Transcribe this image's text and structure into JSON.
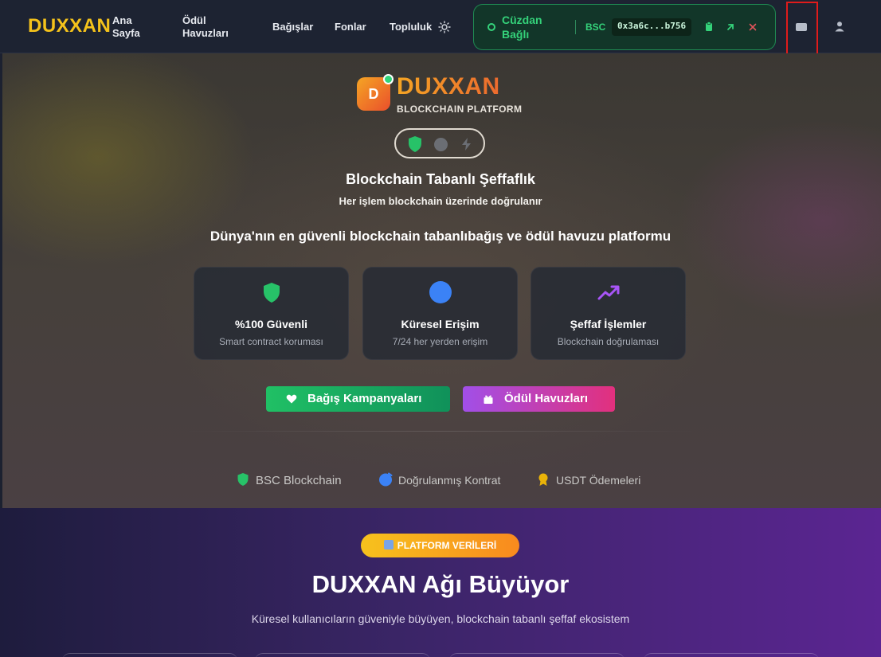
{
  "nav": {
    "brand": "DUXXAN",
    "links": [
      "Ana Sayfa",
      "Ödül Havuzları",
      "Bağışlar",
      "Fonlar",
      "Topluluk"
    ]
  },
  "wallet": {
    "status": "Cüzdan Bağlı",
    "network": "BSC",
    "address": "0x3a6c...b756"
  },
  "hero": {
    "logo_letter": "D",
    "logo_title": "DUXXAN",
    "logo_subtitle": "BLOCKCHAIN PLATFORM",
    "title": "Blockchain Tabanlı Şeffaflık",
    "subtitle": "Her işlem blockchain üzerinde doğrulanır",
    "tagline": "Dünya'nın en güvenli blockchain tabanlıbağış ve ödül havuzu platformu",
    "features": [
      {
        "title": "%100 Güvenli",
        "desc": "Smart contract koruması"
      },
      {
        "title": "Küresel Erişim",
        "desc": "7/24 her yerden erişim"
      },
      {
        "title": "Şeffaf İşlemler",
        "desc": "Blockchain doğrulaması"
      }
    ],
    "buttons": {
      "donations": "Bağış Kampanyaları",
      "rewards": "Ödül Havuzları"
    },
    "trust": [
      "BSC Blockchain",
      "Doğrulanmış Kontrat",
      "USDT Ödemeleri"
    ]
  },
  "stats": {
    "badge": "PLATFORM VERİLERİ",
    "title": "DUXXAN Ağı Büyüyor",
    "subtitle": "Küresel kullanıcıların güveniyle büyüyen, blockchain tabanlı şeffaf ekosistem"
  },
  "colors": {
    "brand_yellow": "#f4c21b",
    "wallet_green": "#34d27a",
    "donate_green": "#20c065",
    "reward_purple": "#a14fe8",
    "reward_pink": "#e2307d"
  },
  "icons": [
    "sun-icon",
    "copy-icon",
    "external-link-icon",
    "close-icon",
    "message-icon",
    "user-icon",
    "shield-icon",
    "globe-icon",
    "trending-up-icon",
    "heart-icon",
    "gift-icon",
    "medal-icon"
  ]
}
